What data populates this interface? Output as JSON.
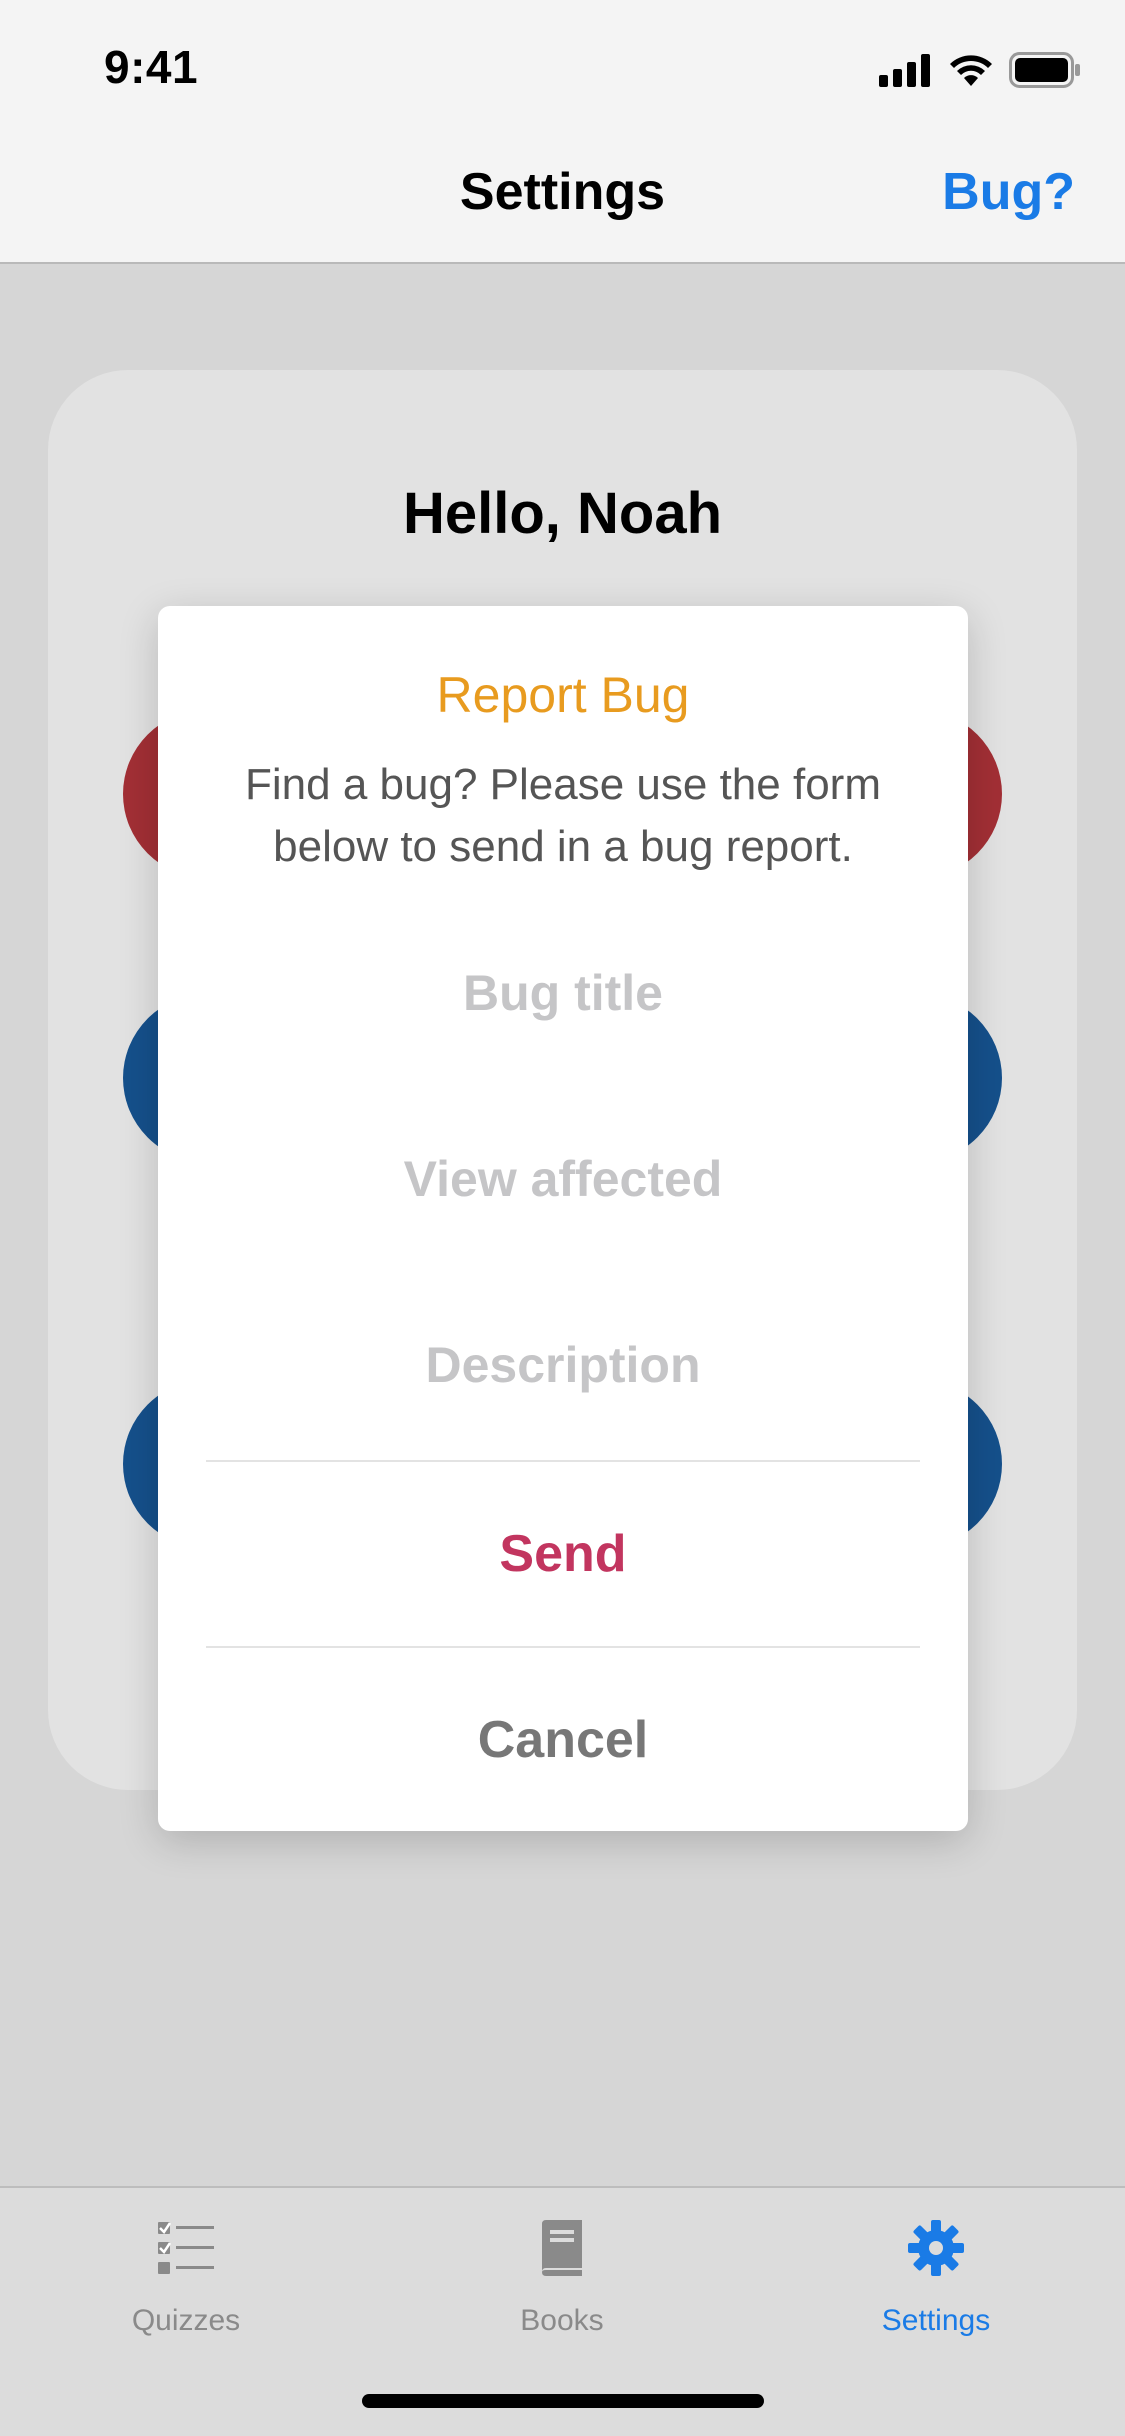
{
  "status_bar": {
    "time": "9:41",
    "icons": [
      "cellular-signal-icon",
      "wifi-icon",
      "battery-icon"
    ]
  },
  "nav": {
    "title": "Settings",
    "action_label": "Bug?"
  },
  "card": {
    "greeting": "Hello, Noah"
  },
  "modal": {
    "title": "Report Bug",
    "description": "Find a bug?  Please use the form below to send in a bug report.",
    "fields": {
      "bug_title": {
        "value": "",
        "placeholder": "Bug title"
      },
      "view_affected": {
        "value": "",
        "placeholder": "View affected"
      },
      "description": {
        "value": "",
        "placeholder": "Description"
      }
    },
    "send_label": "Send",
    "cancel_label": "Cancel"
  },
  "tabs": [
    {
      "label": "Quizzes",
      "icon": "checklist-icon",
      "selected": false
    },
    {
      "label": "Books",
      "icon": "book-icon",
      "selected": false
    },
    {
      "label": "Settings",
      "icon": "gear-icon",
      "selected": true
    }
  ],
  "colors": {
    "accent": "#1a7be6",
    "modal_title": "#e89b1f",
    "send": "#c2355f",
    "red_pill": "#a22f35",
    "blue_pill": "#15508b"
  }
}
